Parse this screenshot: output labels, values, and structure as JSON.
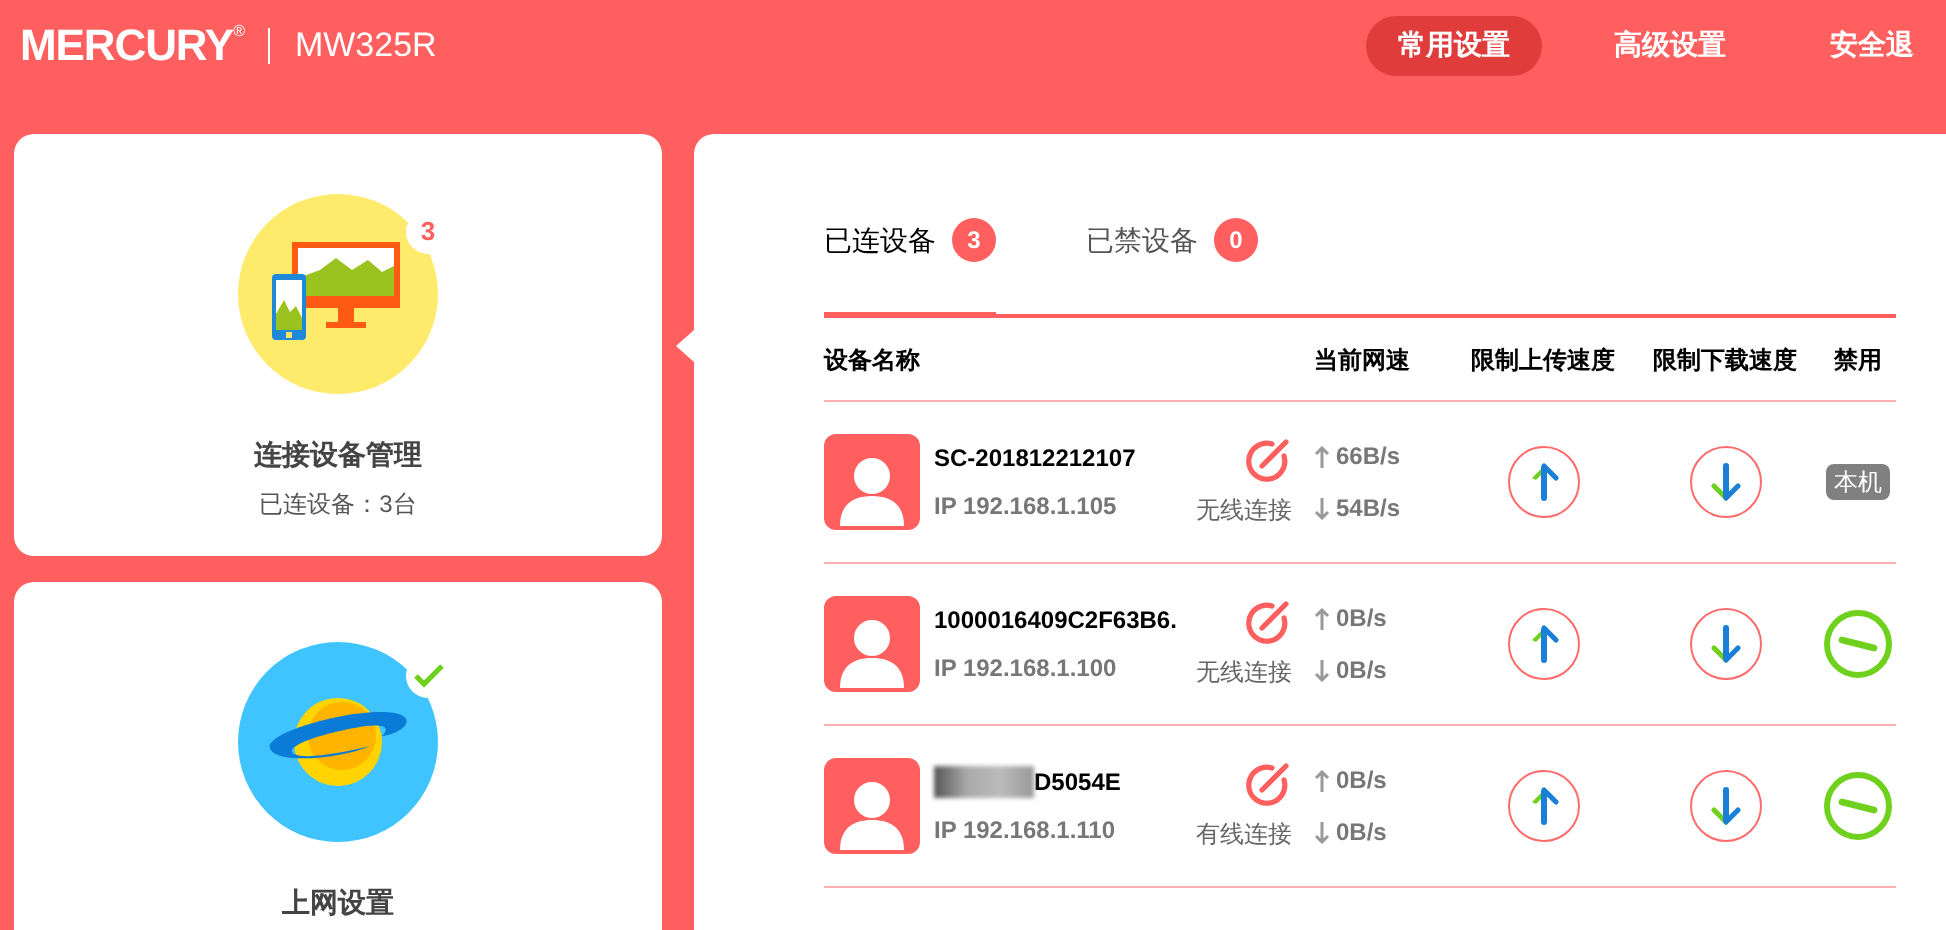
{
  "header": {
    "brand": "MERCURY",
    "brand_mark": "®",
    "model": "MW325R",
    "nav": [
      {
        "label": "常用设置",
        "selected": true
      },
      {
        "label": "高级设置",
        "selected": false
      },
      {
        "label": "安全退",
        "selected": false
      }
    ]
  },
  "sidebar": {
    "cards": [
      {
        "kind": "devices",
        "title": "连接设备管理",
        "subtitle": "已连设备：3台",
        "badge": "3"
      },
      {
        "kind": "internet",
        "title": "上网设置",
        "status_ok": true
      }
    ]
  },
  "tabs": [
    {
      "label": "已连设备",
      "count": "3",
      "selected": true
    },
    {
      "label": "已禁设备",
      "count": "0",
      "selected": false
    }
  ],
  "table": {
    "columns": [
      "设备名称",
      "当前网速",
      "限制上传速度",
      "限制下载速度",
      "禁用"
    ],
    "rows": [
      {
        "name": "SC-201812212107",
        "redacted": false,
        "ip": "IP 192.168.1.105",
        "connection": "无线连接",
        "up": "66B/s",
        "down": "54B/s",
        "disable": {
          "kind": "badge",
          "text": "本机"
        }
      },
      {
        "name": "1000016409C2F63B6.",
        "redacted": false,
        "ip": "IP 192.168.1.100",
        "connection": "无线连接",
        "up": "0B/s",
        "down": "0B/s",
        "disable": {
          "kind": "button"
        }
      },
      {
        "name": "D5054E",
        "redacted": true,
        "ip": "IP 192.168.1.110",
        "connection": "有线连接",
        "up": "0B/s",
        "down": "0B/s",
        "disable": {
          "kind": "button"
        }
      }
    ]
  }
}
